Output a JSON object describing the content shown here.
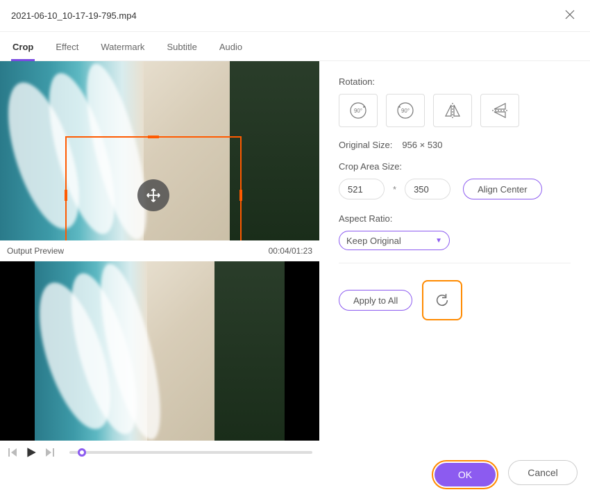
{
  "window": {
    "title": "2021-06-10_10-17-19-795.mp4"
  },
  "tabs": {
    "crop": "Crop",
    "effect": "Effect",
    "watermark": "Watermark",
    "subtitle": "Subtitle",
    "audio": "Audio",
    "active": "crop"
  },
  "preview": {
    "output_label": "Output Preview",
    "time_display": "00:04/01:23"
  },
  "rotation": {
    "label": "Rotation:"
  },
  "original_size": {
    "label": "Original Size:",
    "value": "956 × 530"
  },
  "crop_area": {
    "label": "Crop Area Size:",
    "width": "521",
    "height": "350",
    "align_center_label": "Align Center"
  },
  "aspect_ratio": {
    "label": "Aspect Ratio:",
    "selected": "Keep Original"
  },
  "apply_all": {
    "label": "Apply to All"
  },
  "footer": {
    "ok": "OK",
    "cancel": "Cancel"
  }
}
